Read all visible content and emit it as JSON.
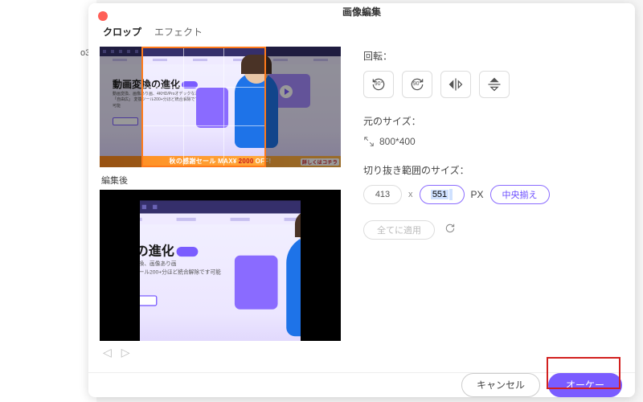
{
  "backdrop_text": "o3",
  "modal": {
    "title": "画像編集",
    "tabs": {
      "crop": "クロップ",
      "effect": "エフェクト"
    },
    "after_label": "編集後",
    "site": {
      "headline": "動画変換の進化",
      "desc": "動画変換、画像あり画、4KHD/Proオデックなど「自由広」\n変換ツール200+分ほど統合解除です可能",
      "sale_prefix": "秋の感謝セール",
      "sale_mid": "MAX¥",
      "sale_amount": "2000",
      "sale_suffix": "OFF!",
      "sale_cap": "詳しくはコチラ"
    }
  },
  "rotate": {
    "label": "回転：",
    "ccw": "90°",
    "cw": "90°"
  },
  "original": {
    "label": "元のサイズ：",
    "value": "800*400"
  },
  "crop": {
    "label": "切り抜き範囲のサイズ：",
    "w": "413",
    "h": "551",
    "x": "x",
    "px": "PX",
    "center": "中央揃え"
  },
  "apply": {
    "all": "全てに適用"
  },
  "footer": {
    "cancel": "キャンセル",
    "ok": "オーケー"
  }
}
